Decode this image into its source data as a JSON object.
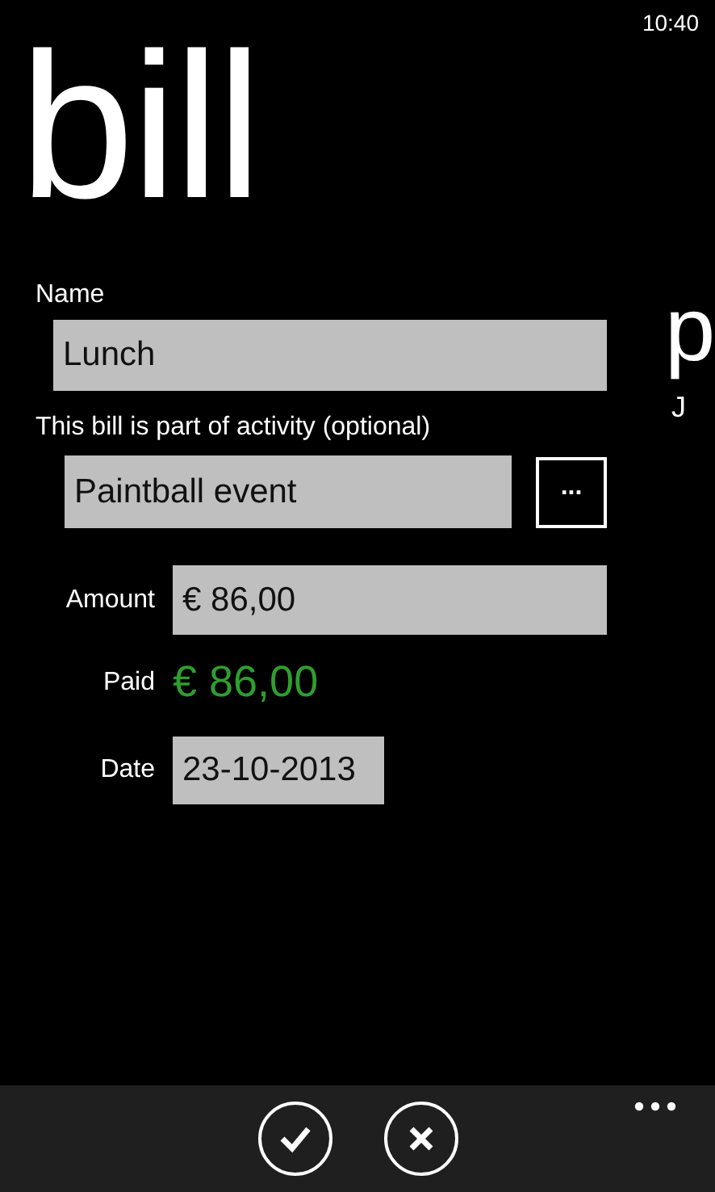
{
  "status_bar": {
    "time": "10:40"
  },
  "title": "bill",
  "form": {
    "name": {
      "label": "Name",
      "value": "Lunch"
    },
    "activity": {
      "label": "This bill is part of activity (optional)",
      "value": "Paintball event",
      "browse_button": "..."
    },
    "amount": {
      "label": "Amount",
      "value": "€ 86,00"
    },
    "paid": {
      "label": "Paid",
      "value": "€ 86,00"
    },
    "date": {
      "label": "Date",
      "value": "23-10-2013"
    }
  },
  "next_pane": {
    "title": "p",
    "subtitle": "J"
  },
  "app_bar": {
    "buttons": [
      {
        "kind": "check"
      },
      {
        "kind": "cancel"
      }
    ]
  }
}
